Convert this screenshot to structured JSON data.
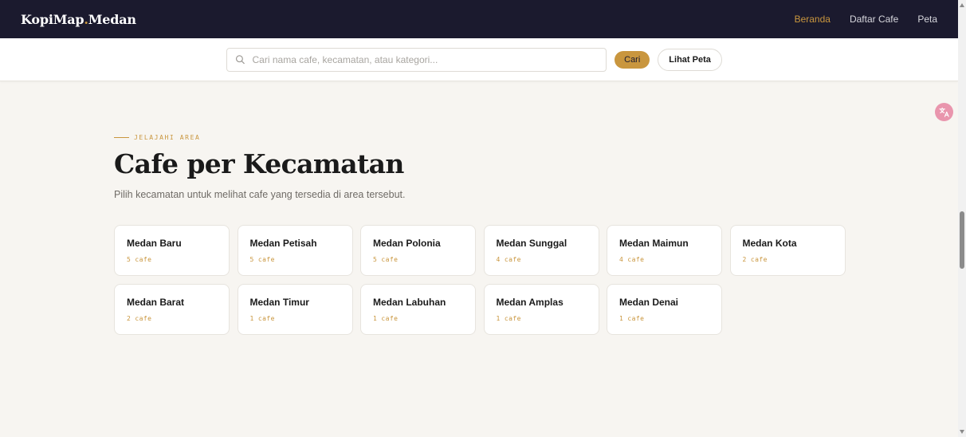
{
  "nav": {
    "brand_main": "KopiMap",
    "brand_dot": ".",
    "brand_suffix": "Medan",
    "links": [
      {
        "label": "Beranda",
        "active": true
      },
      {
        "label": "Daftar Cafe",
        "active": false
      },
      {
        "label": "Peta",
        "active": false
      }
    ]
  },
  "search": {
    "placeholder": "Cari nama cafe, kecamatan, atau kategori...",
    "value": "",
    "submit_label": "Cari",
    "map_label": "Lihat Peta",
    "icon": "search-icon"
  },
  "section": {
    "eyebrow": "JELAJAHI AREA",
    "title": "Cafe per Kecamatan",
    "subtitle": "Pilih kecamatan untuk melihat cafe yang tersedia di area tersebut."
  },
  "districts": [
    {
      "name": "Medan Baru",
      "count": "5 cafe"
    },
    {
      "name": "Medan Petisah",
      "count": "5 cafe"
    },
    {
      "name": "Medan Polonia",
      "count": "5 cafe"
    },
    {
      "name": "Medan Sunggal",
      "count": "4 cafe"
    },
    {
      "name": "Medan Maimun",
      "count": "4 cafe"
    },
    {
      "name": "Medan Kota",
      "count": "2 cafe"
    },
    {
      "name": "Medan Barat",
      "count": "2 cafe"
    },
    {
      "name": "Medan Timur",
      "count": "1 cafe"
    },
    {
      "name": "Medan Labuhan",
      "count": "1 cafe"
    },
    {
      "name": "Medan Amplas",
      "count": "1 cafe"
    },
    {
      "name": "Medan Denai",
      "count": "1 cafe"
    }
  ],
  "colors": {
    "nav_bg": "#1b1a2e",
    "accent": "#c9963e",
    "page_bg": "#f7f5f1"
  },
  "translate_widget": {
    "icon": "translate-icon"
  }
}
